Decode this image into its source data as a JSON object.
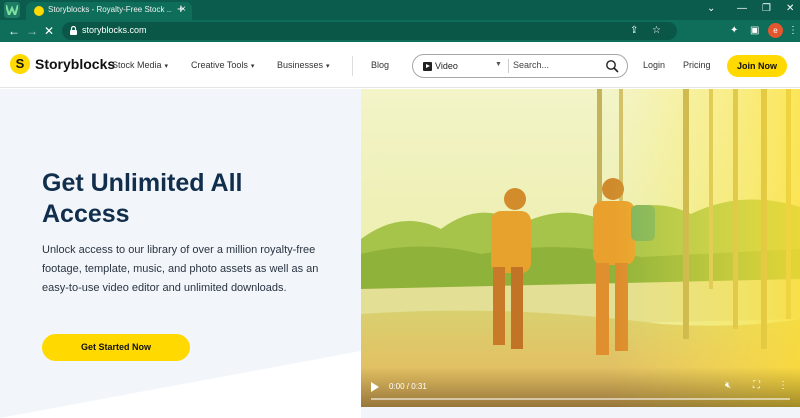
{
  "browser": {
    "tab_title": "Storyblocks - Royalty-Free Stock ...",
    "tab_close": "×",
    "new_tab": "+",
    "url": "storyblocks.com",
    "profile_initial": "e",
    "minimize": "⌄",
    "window_min": "—",
    "window_restore": "❐",
    "window_close": "✕"
  },
  "header": {
    "logo_mark": "S",
    "logo_text": "Storyblocks",
    "nav": {
      "stock_media": "Stock Media",
      "creative_tools": "Creative Tools",
      "businesses": "Businesses",
      "blog": "Blog"
    },
    "search": {
      "type": "Video",
      "placeholder": "Search..."
    },
    "login": "Login",
    "pricing": "Pricing",
    "join": "Join Now"
  },
  "hero": {
    "title": "Get Unlimited All Access",
    "description": "Unlock access to our library of over a million royalty-free footage, template, music, and photo assets as well as an easy-to-use video editor and unlimited downloads.",
    "cta": "Get Started Now"
  },
  "video": {
    "time": "0:00 / 0:31",
    "progress": 0.0,
    "muted": true
  },
  "colors": {
    "brand_yellow": "#ffd900",
    "chrome_green": "#0f6e5a",
    "title_navy": "#112e4c"
  }
}
